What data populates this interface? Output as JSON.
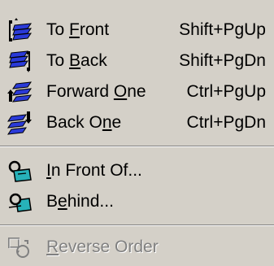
{
  "menu": {
    "items": [
      {
        "prefix": "To ",
        "mnemonic": "F",
        "suffix": "ront",
        "shortcut": "Shift+PgUp",
        "icon": "bring-to-front-icon"
      },
      {
        "prefix": "To ",
        "mnemonic": "B",
        "suffix": "ack",
        "shortcut": "Shift+PgDn",
        "icon": "send-to-back-icon"
      },
      {
        "prefix": "Forward ",
        "mnemonic": "O",
        "suffix": "ne",
        "shortcut": "Ctrl+PgUp",
        "icon": "bring-forward-icon"
      },
      {
        "prefix": "Back O",
        "mnemonic": "n",
        "suffix": "e",
        "shortcut": "Ctrl+PgDn",
        "icon": "send-backward-icon"
      }
    ],
    "items2": [
      {
        "prefix": "",
        "mnemonic": "I",
        "suffix": "n Front Of...",
        "icon": "in-front-of-icon"
      },
      {
        "prefix": "B",
        "mnemonic": "e",
        "suffix": "hind...",
        "icon": "behind-icon"
      }
    ],
    "items3": [
      {
        "prefix": "",
        "mnemonic": "R",
        "suffix": "everse Order",
        "icon": "reverse-order-icon",
        "disabled": true
      }
    ],
    "colors": {
      "background": "#d4d0c8",
      "icon_blue": "#2a3ad8",
      "icon_teal": "#27b2b9",
      "icon_dark": "#000000",
      "disabled_text": "#808080"
    }
  }
}
